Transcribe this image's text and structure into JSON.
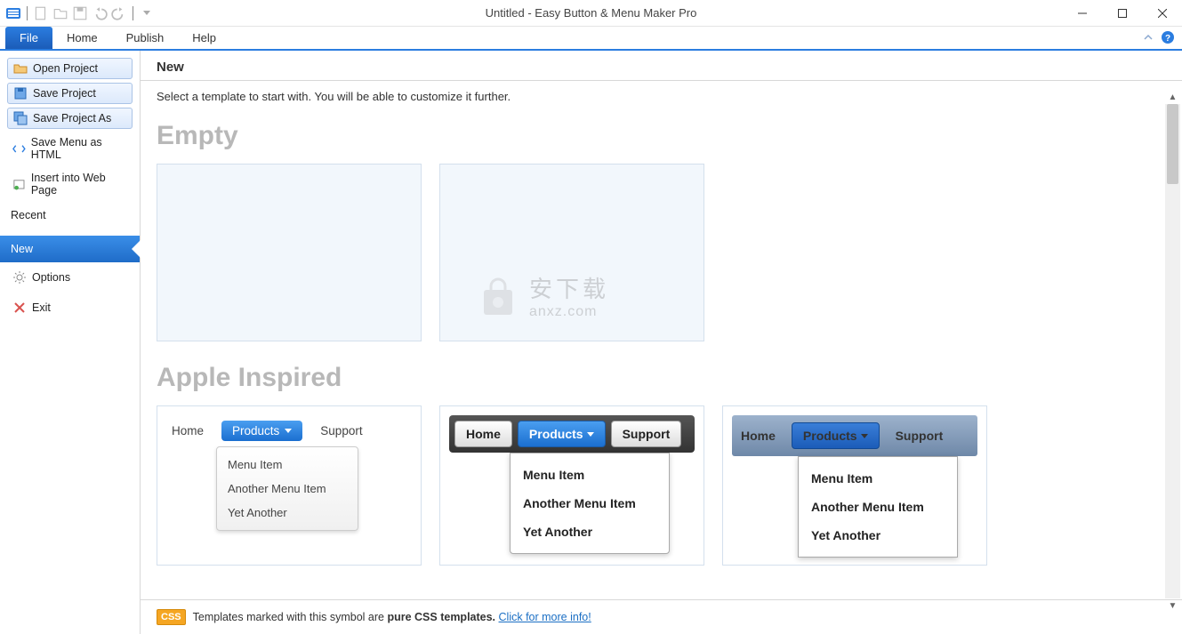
{
  "titlebar": {
    "title": "Untitled - Easy Button & Menu Maker Pro"
  },
  "ribbon": {
    "file": "File",
    "tabs": [
      "Home",
      "Publish",
      "Help"
    ]
  },
  "sidebar": {
    "buttons": {
      "open": "Open Project",
      "save": "Save Project",
      "saveas": "Save Project As"
    },
    "links": {
      "savehtml": "Save Menu as HTML",
      "insert": "Insert into Web Page"
    },
    "recent": "Recent",
    "new": "New",
    "options": "Options",
    "exit": "Exit"
  },
  "main": {
    "header": "New",
    "subtitle": "Select a template to start with. You will be able to customize it further.",
    "sections": {
      "empty": "Empty",
      "apple": "Apple Inspired"
    },
    "preview_menu": {
      "home": "Home",
      "products": "Products",
      "support": "Support",
      "items": [
        "Menu Item",
        "Another Menu Item",
        "Yet Another"
      ]
    },
    "watermark": {
      "cn": "安下载",
      "en": "anxz.com"
    }
  },
  "footer": {
    "badge": "CSS",
    "text_prefix": "Templates marked with this symbol are ",
    "text_bold": "pure CSS templates.",
    "link": "Click for more info!"
  }
}
